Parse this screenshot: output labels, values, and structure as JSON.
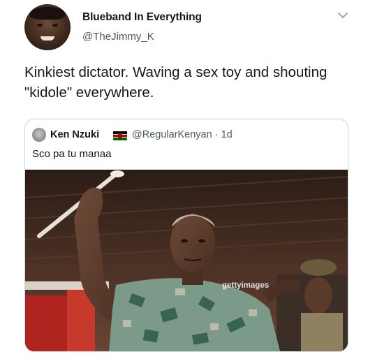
{
  "tweet": {
    "author": {
      "display_name": "Blueband In Everything",
      "handle": "@TheJimmy_K"
    },
    "text": "Kinkiest dictator. Waving a sex toy and shouting \"kidole\" everywhere.",
    "menu_icon": "chevron-down-icon"
  },
  "quoted_tweet": {
    "author": {
      "display_name": "Ken Nzuki",
      "flag": "kenya-flag-icon",
      "handle": "@RegularKenyan",
      "separator": "·",
      "time": "1d"
    },
    "text": "Sco pa tu manaa",
    "media": {
      "watermark": "gettyimages"
    }
  },
  "colors": {
    "text_primary": "#14171a",
    "text_secondary": "#4e5861",
    "border": "#ccd6dd"
  }
}
